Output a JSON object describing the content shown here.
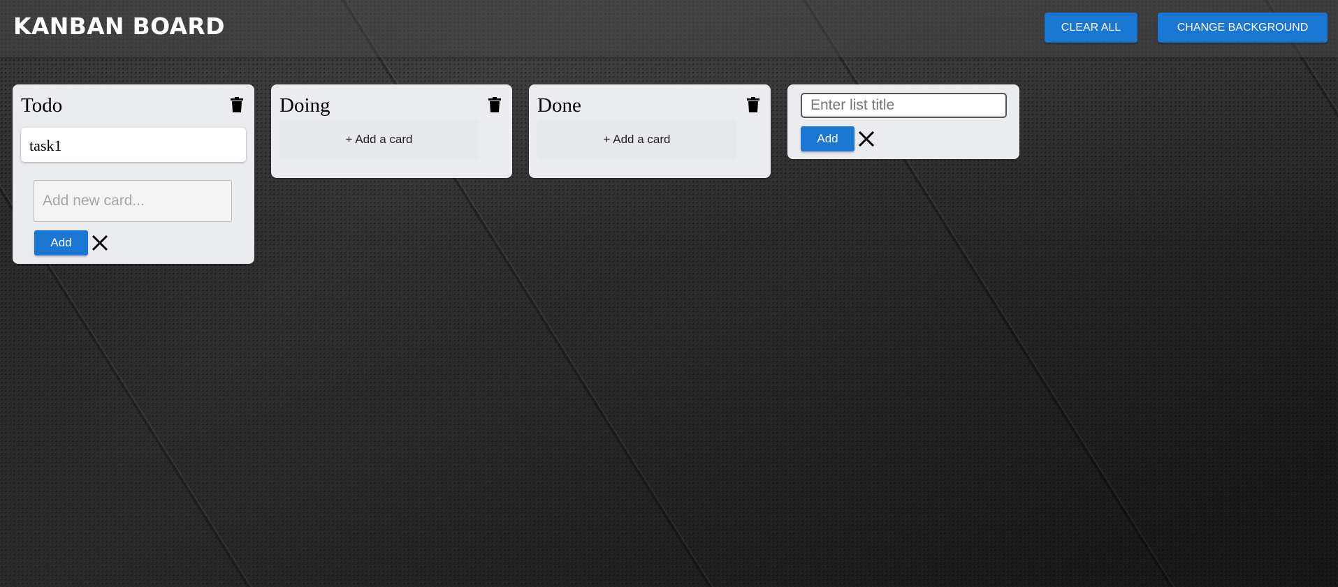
{
  "header": {
    "title": "KANBAN BOARD",
    "clear_all_label": "CLEAR ALL",
    "change_background_label": "CHANGE BACKGROUND"
  },
  "lists": [
    {
      "title": "Todo",
      "cards": [
        "task1"
      ],
      "new_card_placeholder": "Add new card...",
      "add_label": "Add"
    },
    {
      "title": "Doing",
      "add_card_label": "+ Add a card"
    },
    {
      "title": "Done",
      "add_card_label": "+ Add a card"
    }
  ],
  "new_list": {
    "placeholder": "Enter list title",
    "add_label": "Add"
  },
  "icons": {
    "delete": "trash-icon",
    "cancel": "close-icon"
  },
  "colors": {
    "accent": "#1976d2",
    "list_background": "#ebecf0",
    "card_background": "#ffffff"
  }
}
